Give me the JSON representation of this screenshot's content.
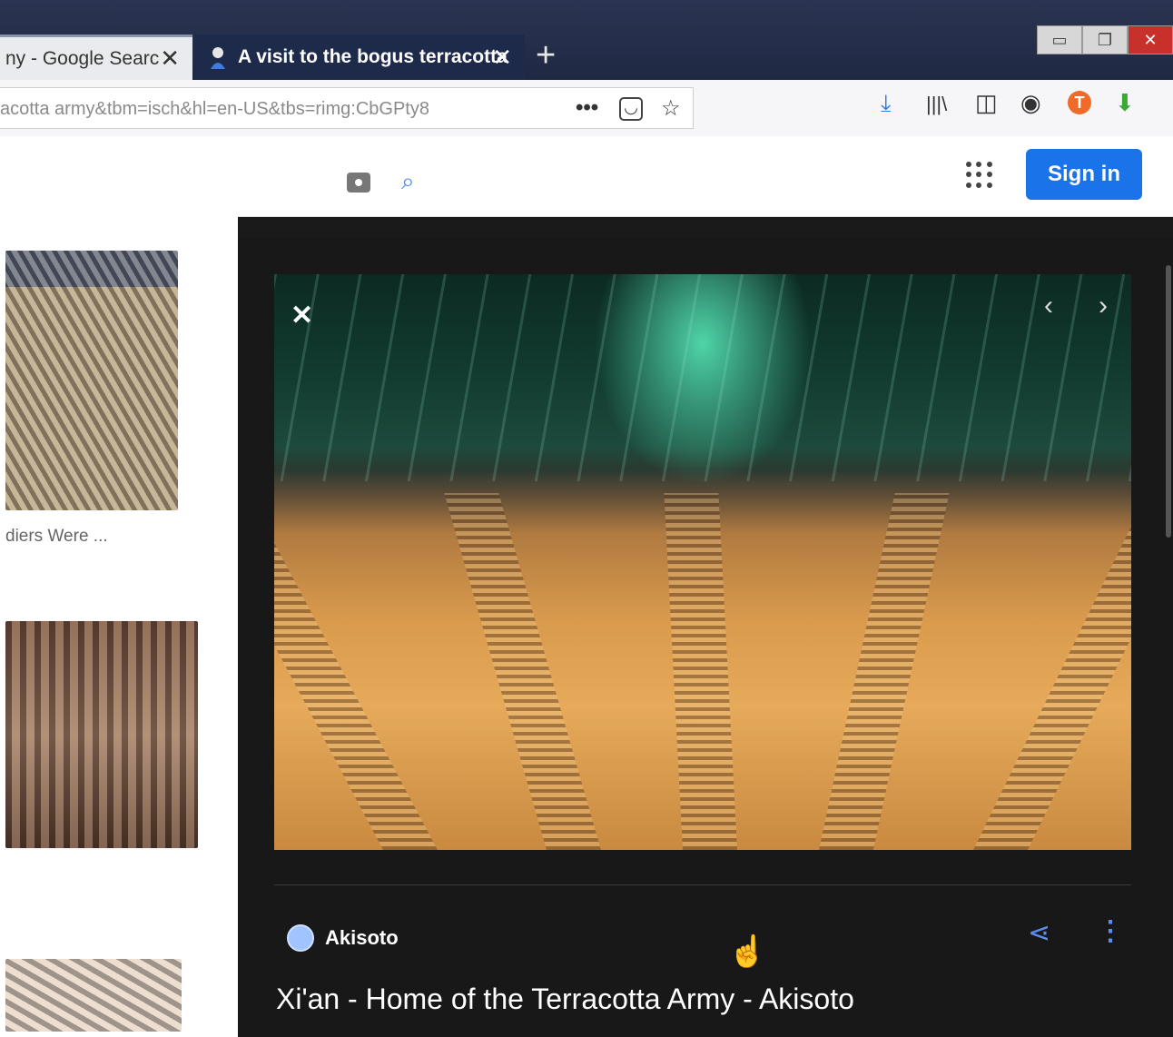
{
  "tabs": [
    {
      "title": "ny - Google Searc",
      "close": "✕",
      "active": false
    },
    {
      "title": "A visit to the bogus terracotta",
      "close": "✕",
      "active": true
    }
  ],
  "new_tab": "+",
  "window_controls": {
    "minimize": "▭",
    "restore": "❐",
    "close": "✕"
  },
  "address": {
    "url": "acotta army&tbm=isch&hl=en-US&tbs=rimg:CbGPty8",
    "more": "•••",
    "pocket": "◡",
    "bookmark": "☆"
  },
  "toolbar": {
    "download": "⤓",
    "library": "|||\\",
    "sidebar": "◫",
    "account": "◉",
    "ext1": "T",
    "ext2": "⬇"
  },
  "header": {
    "sign_in": "Sign in",
    "search_icon": "⌕"
  },
  "results": {
    "caption": "diers Were ..."
  },
  "viewer": {
    "close": "✕",
    "prev": "‹",
    "next": "›",
    "source": "Akisoto",
    "share": "⋖",
    "more": "⋮",
    "title": "Xi'an - Home of the Terracotta Army - Akisoto"
  },
  "colors": {
    "accent": "#1a73e8",
    "viewer_bg": "#181818",
    "icon_blue": "#5b8def"
  }
}
